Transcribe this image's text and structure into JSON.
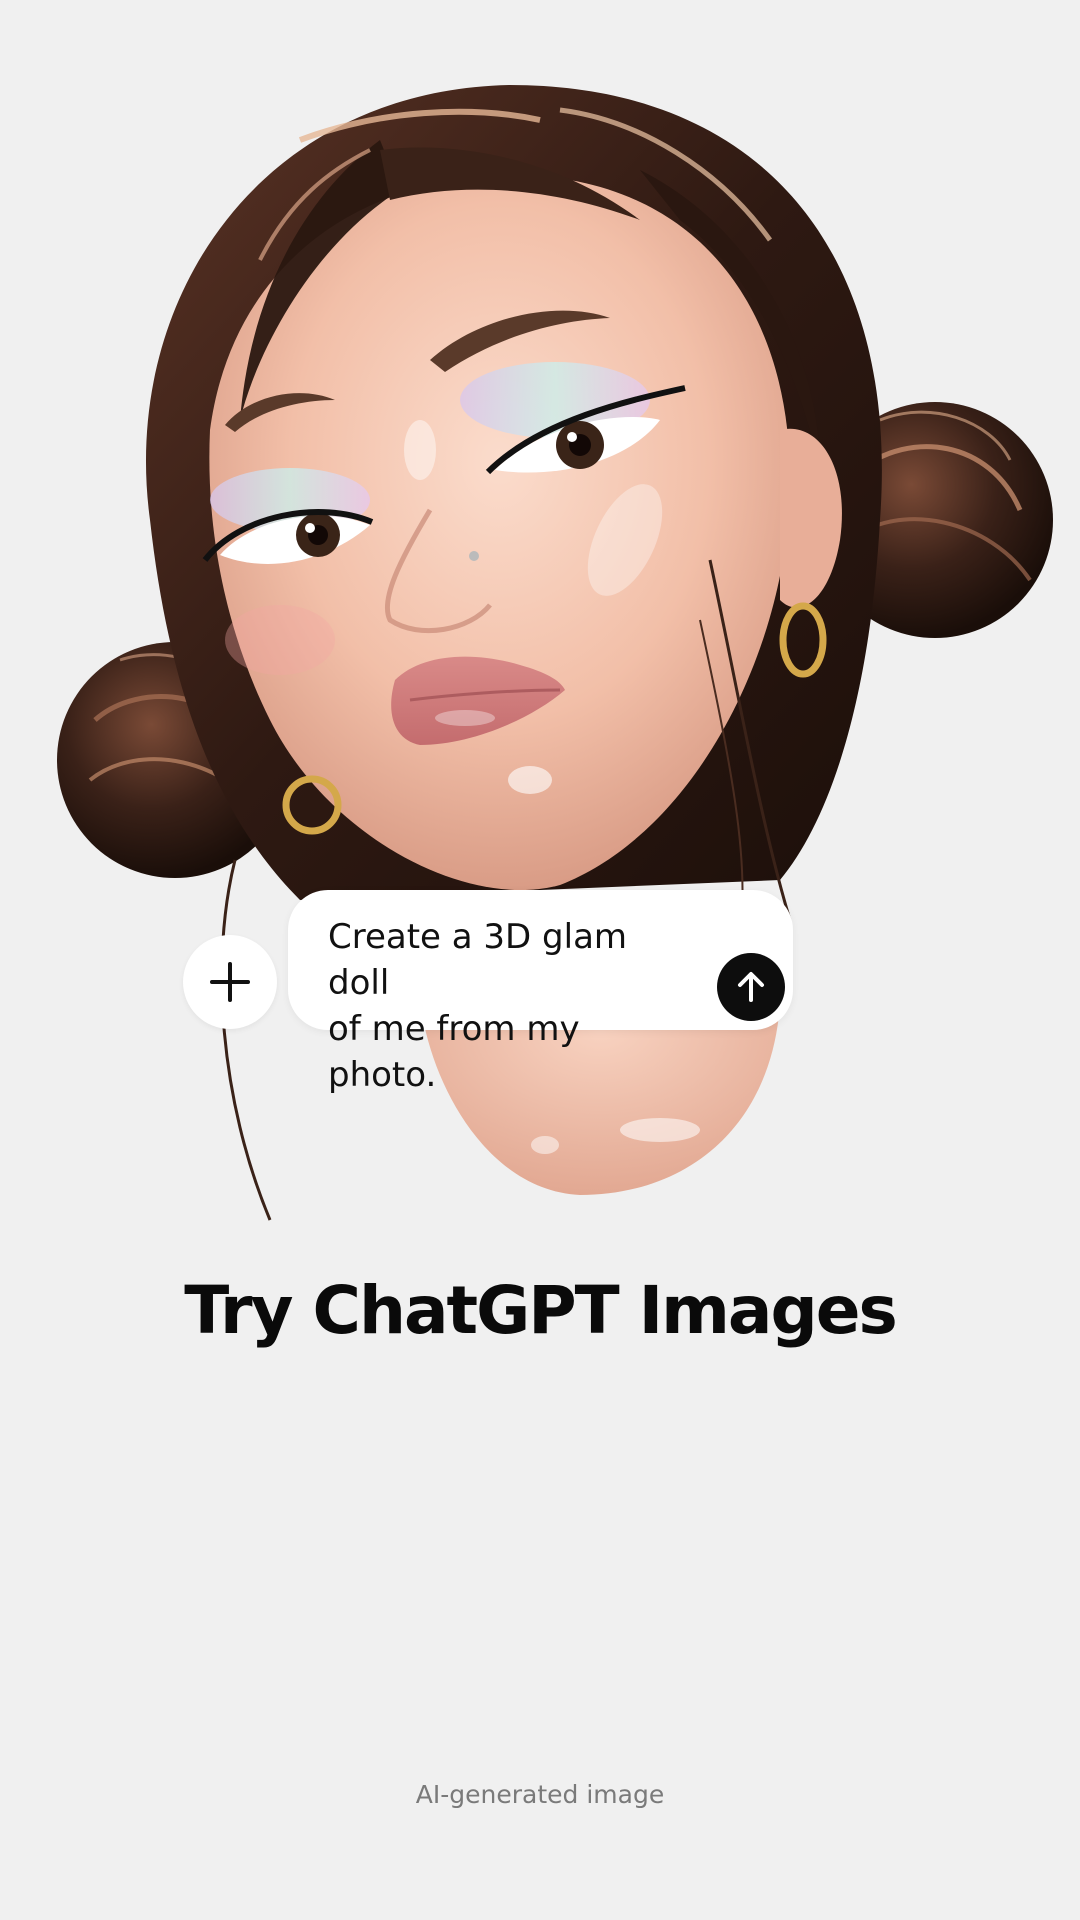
{
  "hero": {
    "image_subject": "3D glam doll portrait illustration"
  },
  "prompt": {
    "text": "Create a 3D glam doll\nof me from my photo.",
    "add_icon": "plus-icon",
    "send_icon": "arrow-up-icon"
  },
  "headline": "Try ChatGPT Images",
  "footnote": "AI-generated image",
  "colors": {
    "background": "#f0f0f0",
    "bubble": "#ffffff",
    "send_button": "#0d0d0d",
    "hair": "#3b2218",
    "skin": "#f2c4b0"
  }
}
